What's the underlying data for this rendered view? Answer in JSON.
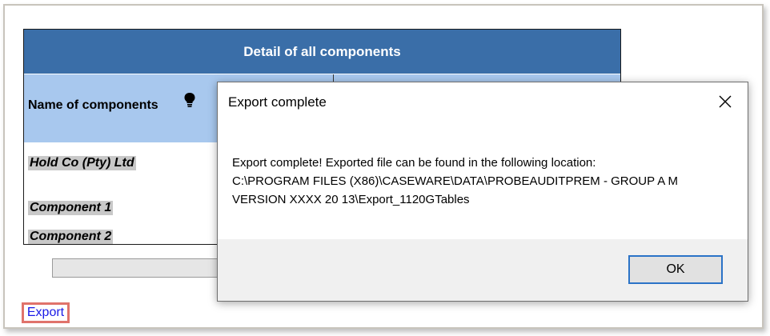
{
  "table": {
    "title": "Detail of all components",
    "column_name_header": "Name of components",
    "components": [
      "Hold Co (Pty) Ltd",
      "Component 1",
      "Component 2"
    ]
  },
  "export_link": "Export",
  "dialog": {
    "title": "Export complete",
    "message_lines": [
      "Export complete! Exported file can be found in the following location:",
      "C:\\PROGRAM FILES (X86)\\CASEWARE\\DATA\\PROBEAUDITPREM - GROUP A M",
      "VERSION XXXX 20 13\\Export_1120GTables"
    ],
    "ok_label": "OK"
  },
  "colors": {
    "header_blue": "#3a6ea8",
    "subheader_blue": "#a8c8ee",
    "highlight_red": "#e0736b",
    "ok_border": "#2b73c7"
  },
  "icons": {
    "bulb": "lightbulb-icon",
    "close": "close-icon"
  }
}
